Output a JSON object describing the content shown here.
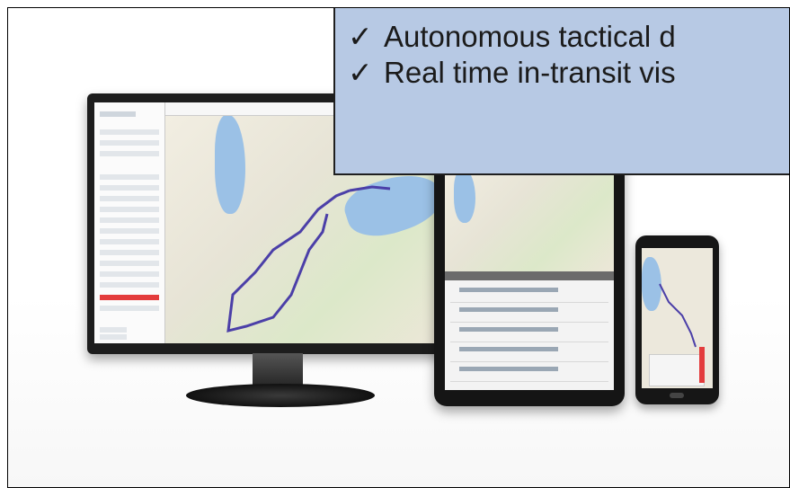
{
  "callout": {
    "items": [
      {
        "check": "✓",
        "text": "Autonomous tactical d"
      },
      {
        "check": "✓",
        "text": "Real time in-transit vis"
      }
    ]
  },
  "devices": {
    "monitor_icon": "desktop-monitor-icon",
    "tablet_icon": "tablet-icon",
    "phone_icon": "smartphone-icon"
  },
  "colors": {
    "callout_bg": "#b7c9e4",
    "route": "#4b3fa8",
    "highlight_row": "#e33c3c"
  }
}
